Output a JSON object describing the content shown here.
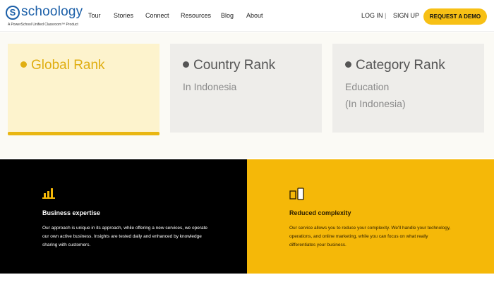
{
  "brand": {
    "name": "schoology",
    "mark": "S",
    "tagline": "A PowerSchool Unified Classroom™ Product",
    "accent": "#1b5fa8"
  },
  "nav": {
    "items": [
      "Tour",
      "Stories",
      "Connect",
      "Resources",
      "Blog",
      "About"
    ],
    "login": "LOG IN",
    "separator": "|",
    "signup": "SIGN UP",
    "cta": "REQUEST A DEMO",
    "cta_color": "#f7c015"
  },
  "ranks": [
    {
      "title": "Global Rank",
      "sub": [],
      "active": true
    },
    {
      "title": "Country Rank",
      "sub": [
        "In Indonesia"
      ],
      "active": false
    },
    {
      "title": "Category Rank",
      "sub": [
        "Education",
        "(In Indonesia)"
      ],
      "active": false
    }
  ],
  "features": {
    "left": {
      "icon": "bar-chart-icon",
      "title": "Business expertise",
      "body": "Our approach is unique in its approach, while offering a new services, we operate our own active business. Insights are tested daily and enhanced by knowledge sharing with customers."
    },
    "right": {
      "icon": "devices-icon",
      "title": "Reduced complexity",
      "body": "Our service allows you to reduce your complexity. We'll handle your technology, operations, and online marketing, while you can focus on what really differentiates your business."
    }
  }
}
